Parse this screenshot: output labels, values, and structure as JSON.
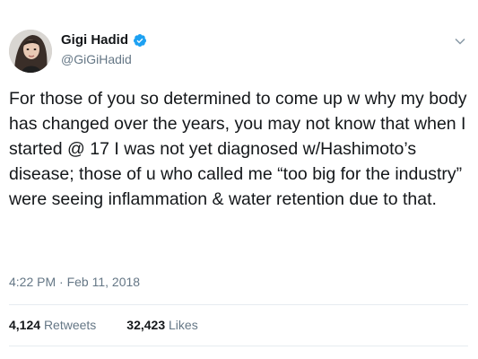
{
  "user": {
    "name": "Gigi Hadid",
    "handle": "@GiGiHadid",
    "verified": true,
    "avatar_icon": "profile-photo"
  },
  "tweet": {
    "text": "For those of you so determined to come up w why my body has changed over the years, you may not know that when I started @ 17 I was not yet diagnosed w/Hashimoto’s disease; those of u who called me “too big for the industry” were seeing inflammation & water retention due to that.",
    "timestamp": "4:22 PM · Feb 11, 2018"
  },
  "stats": {
    "retweets_count": "4,124",
    "retweets_label": "Retweets",
    "likes_count": "32,423",
    "likes_label": "Likes"
  },
  "colors": {
    "text": "#14171a",
    "muted": "#657786",
    "verified_blue": "#1da1f2",
    "divider": "#e6ecf0"
  }
}
